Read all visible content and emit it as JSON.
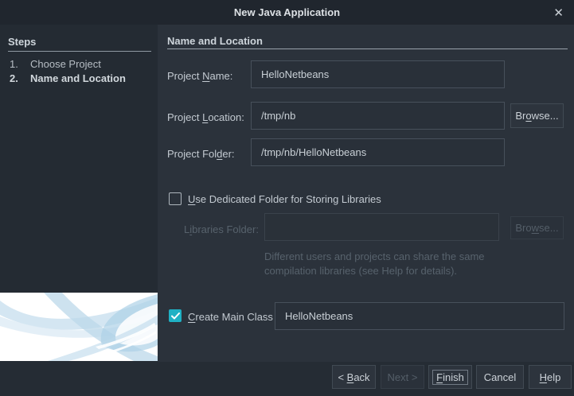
{
  "window": {
    "title": "New Java Application",
    "close_icon": "✕"
  },
  "steps_panel": {
    "title": "Steps",
    "items": [
      {
        "num": "1.",
        "label": "Choose Project"
      },
      {
        "num": "2.",
        "label": "Name and Location"
      }
    ]
  },
  "main": {
    "header": "Name and Location",
    "project_name": {
      "label": "Project Name:",
      "mnemonic": "N",
      "value": "HelloNetbeans"
    },
    "project_location": {
      "label": "Project Location:",
      "mnemonic": "L",
      "value": "/tmp/nb"
    },
    "project_folder": {
      "label": "Project Folder:",
      "mnemonic": "d",
      "value": "/tmp/nb/HelloNetbeans"
    },
    "browse_location": {
      "label": "Browse...",
      "mnemonic": "o"
    },
    "dedicated_folder": {
      "checkbox_label": "Use Dedicated Folder for Storing Libraries",
      "mnemonic": "U",
      "checked": false,
      "libraries_folder": {
        "label": "Libraries Folder:",
        "mnemonic": "i",
        "value": ""
      },
      "browse": {
        "label": "Browse...",
        "mnemonic": "w"
      },
      "hint_line1": "Different users and projects can share the same",
      "hint_line2": "compilation libraries (see Help for details)."
    },
    "main_class": {
      "checkbox_label": "Create Main Class",
      "mnemonic": "C",
      "checked": true,
      "value": "HelloNetbeans"
    }
  },
  "footer": {
    "buttons": [
      {
        "label": "< Back",
        "mnemonic": "B",
        "enabled": true
      },
      {
        "label": "Next >",
        "enabled": false
      },
      {
        "label": "Finish",
        "mnemonic": "F",
        "enabled": true,
        "focused": true
      },
      {
        "label": "Cancel",
        "enabled": true
      },
      {
        "label": "Help",
        "mnemonic": "H",
        "enabled": true
      }
    ]
  },
  "colors": {
    "accent_checkbox": "#1fb1c4",
    "brand_swoosh_blue": "#bad7ea",
    "titlebar_bg": "#20262e",
    "panel_bg": "#2b323b",
    "sidebar_bg": "#242b33"
  }
}
